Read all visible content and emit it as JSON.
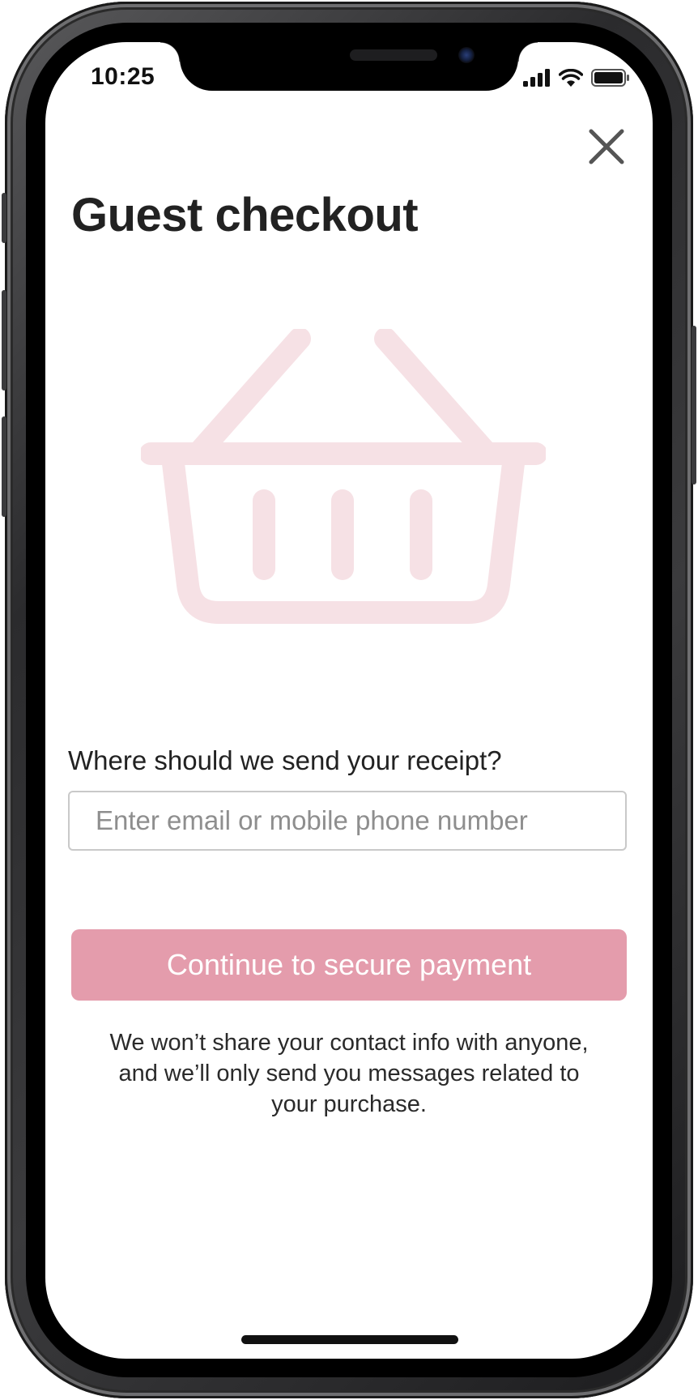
{
  "status_bar": {
    "time": "10:25",
    "icons": [
      "cellular-signal-icon",
      "wifi-icon",
      "battery-icon"
    ]
  },
  "header": {
    "close_icon": "close-icon",
    "title": "Guest checkout"
  },
  "illustration": {
    "icon": "shopping-basket-icon",
    "color": "#f6e1e5"
  },
  "form": {
    "label": "Where should we send your receipt?",
    "placeholder": "Enter email or mobile phone number",
    "value": ""
  },
  "actions": {
    "continue_label": "Continue to secure payment",
    "accent_color": "#e49cac"
  },
  "privacy_note": "We won’t share your contact info with anyone, and we’ll only send you messages related to your purchase."
}
